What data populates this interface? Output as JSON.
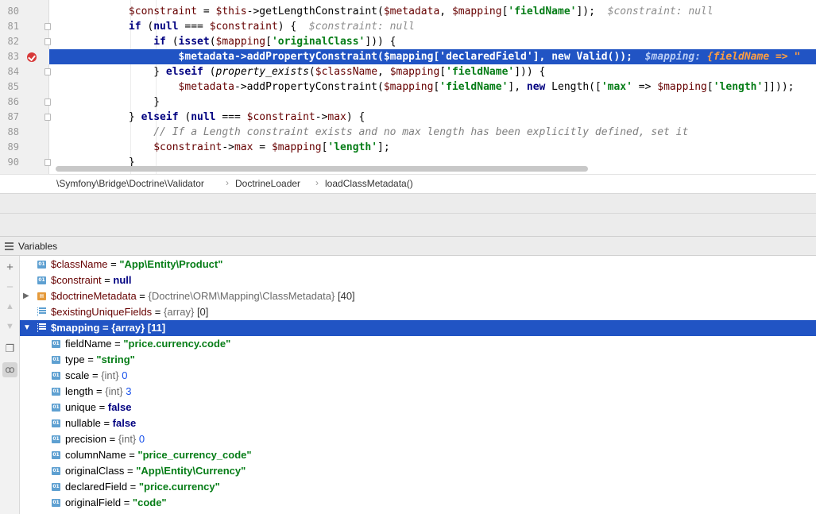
{
  "editor": {
    "lines": [
      {
        "num": "80",
        "hint": "$constraint: null"
      },
      {
        "num": "81",
        "hint": "$constraint: null"
      },
      {
        "num": "82"
      },
      {
        "num": "83",
        "hint": "$mapping: ",
        "hint_value": "{fieldName => \""
      },
      {
        "num": "84"
      },
      {
        "num": "85"
      },
      {
        "num": "86"
      },
      {
        "num": "87"
      },
      {
        "num": "88",
        "comment": "// If a Length constraint exists and no max length has been explicitly defined, set it"
      },
      {
        "num": "89"
      },
      {
        "num": "90"
      }
    ]
  },
  "breadcrumb": {
    "items": [
      "\\Symfony\\Bridge\\Doctrine\\Validator",
      "DoctrineLoader",
      "loadClassMetadata()"
    ]
  },
  "panel": {
    "title": "Variables"
  },
  "variables": [
    {
      "name": "$className",
      "eq": " = ",
      "value": "\"App\\Entity\\Product\"",
      "kind": "str"
    },
    {
      "name": "$constraint",
      "eq": " = ",
      "value": "null",
      "kind": "plain"
    },
    {
      "name": "$doctrineMetadata",
      "eq": " = ",
      "type": "{Doctrine\\ORM\\Mapping\\ClassMetadata}",
      "count": " [40]",
      "kind": "obj"
    },
    {
      "name": "$existingUniqueFields",
      "eq": " = ",
      "type": "{array}",
      "count": " [0]",
      "kind": "arr"
    },
    {
      "name": "$mapping",
      "eq": " = ",
      "type": "{array}",
      "count": " [11]",
      "kind": "arr-open"
    }
  ],
  "mapping_items": [
    {
      "name": "fieldName",
      "value": "\"price.currency.code\"",
      "kind": "str"
    },
    {
      "name": "type",
      "value": "\"string\"",
      "kind": "str"
    },
    {
      "name": "scale",
      "type": "{int}",
      "value": "0",
      "kind": "num"
    },
    {
      "name": "length",
      "type": "{int}",
      "value": "3",
      "kind": "num"
    },
    {
      "name": "unique",
      "value": "false",
      "kind": "bool"
    },
    {
      "name": "nullable",
      "value": "false",
      "kind": "bool"
    },
    {
      "name": "precision",
      "type": "{int}",
      "value": "0",
      "kind": "num"
    },
    {
      "name": "columnName",
      "value": "\"price_currency_code\"",
      "kind": "str"
    },
    {
      "name": "originalClass",
      "value": "\"App\\Entity\\Currency\"",
      "kind": "str"
    },
    {
      "name": "declaredField",
      "value": "\"price.currency\"",
      "kind": "str"
    },
    {
      "name": "originalField",
      "value": "\"code\"",
      "kind": "str"
    }
  ],
  "icons": {
    "breakpoint": "breakpoint-icon",
    "toolbar": [
      "add-watch-icon",
      "remove-watch-icon",
      "move-up-icon",
      "move-down-icon",
      "copy-icon",
      "show-watches-icon"
    ]
  },
  "colors": {
    "selection": "#2154c4",
    "string": "#067d17",
    "keyword": "#000080",
    "variable": "#660000",
    "breakpoint": "#d73939"
  }
}
